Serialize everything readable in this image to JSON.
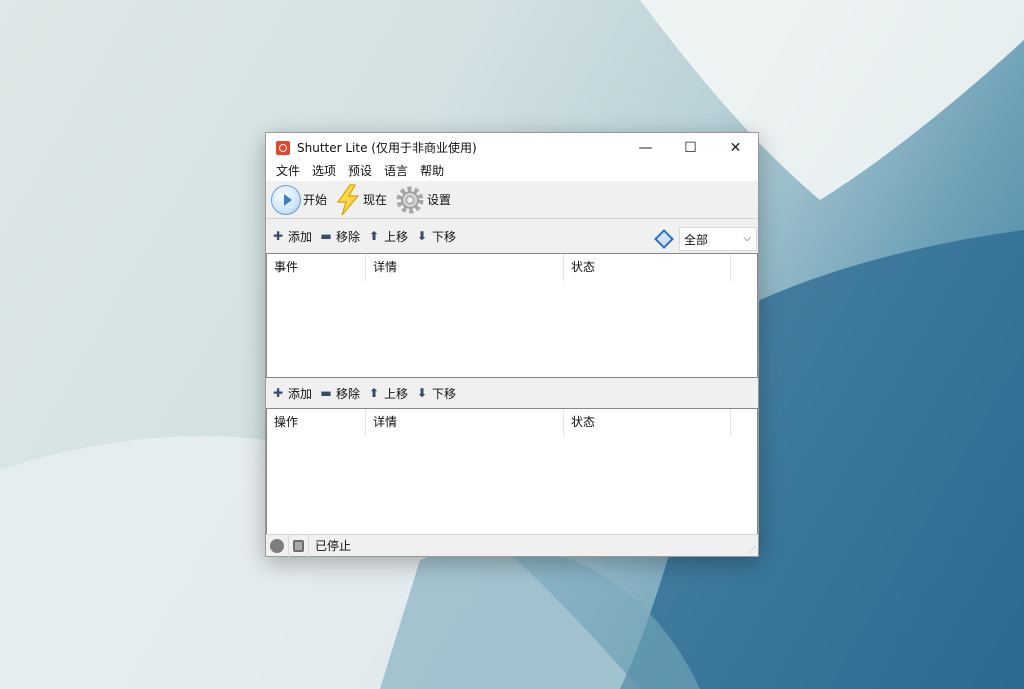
{
  "window": {
    "title": "Shutter Lite (仅用于非商业使用)",
    "controls": {
      "minimize": "—",
      "maximize": "☐",
      "close": "✕"
    }
  },
  "menu": [
    "文件",
    "选项",
    "预设",
    "语言",
    "帮助"
  ],
  "toolbar": {
    "start": "开始",
    "now": "现在",
    "settings": "设置"
  },
  "events_panel": {
    "actions": {
      "add": "添加",
      "remove": "移除",
      "up": "上移",
      "down": "下移"
    },
    "filter": {
      "selected": "全部"
    },
    "columns": [
      "事件",
      "详情",
      "状态",
      ""
    ]
  },
  "actions_panel": {
    "actions": {
      "add": "添加",
      "remove": "移除",
      "up": "上移",
      "down": "下移"
    },
    "columns": [
      "操作",
      "详情",
      "状态",
      ""
    ]
  },
  "status": {
    "text": "已停止"
  },
  "colors": {
    "accent": "#3d7fbf",
    "app_icon": "#e5452f"
  }
}
